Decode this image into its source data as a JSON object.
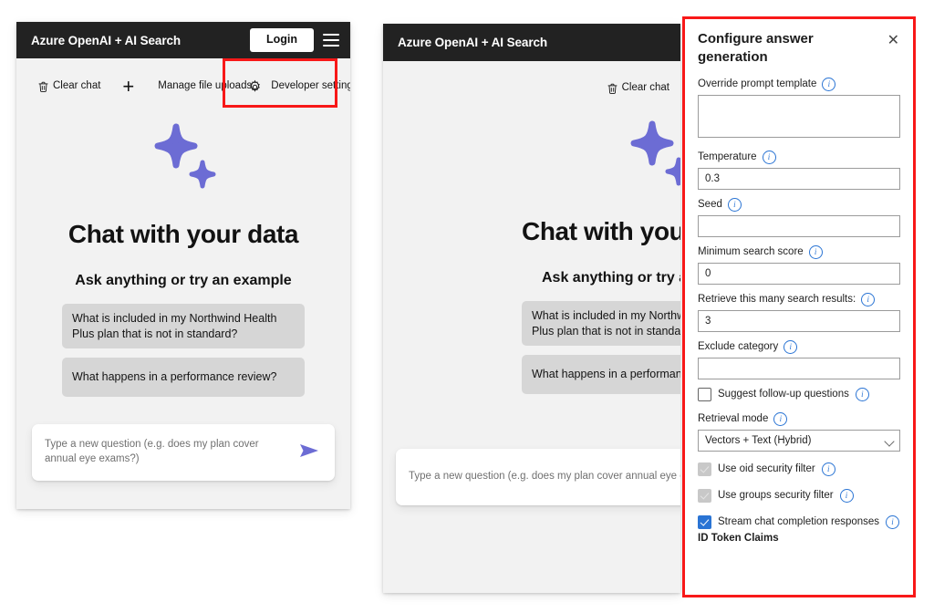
{
  "app": {
    "title": "Azure OpenAI + AI Search",
    "login_label": "Login",
    "menu_icon": "hamburger-menu-icon"
  },
  "command_bar": {
    "clear_chat_label": "Clear chat",
    "clear_chat_icon": "trash-icon",
    "add_icon": "plus-icon",
    "manage_uploads_label": "Manage file uploads",
    "developer_settings_label": "Developer settings",
    "developer_settings_icon": "gear-icon"
  },
  "chat": {
    "sparkle_icon": "sparkles-icon",
    "title": "Chat with your data",
    "subtitle": "Ask anything or try an example",
    "examples": [
      "What is included in my Northwind Health Plus plan that is not in standard?",
      "What happens in a performance review?"
    ],
    "input_placeholder": "Type a new question (e.g. does my plan cover annual eye exams?)",
    "send_icon": "send-arrow-icon"
  },
  "settings": {
    "title": "Configure answer generation",
    "close_icon": "close-icon",
    "info_icon": "info-icon",
    "fields": {
      "override_prompt": {
        "label": "Override prompt template",
        "value": ""
      },
      "temperature": {
        "label": "Temperature",
        "value": "0.3"
      },
      "seed": {
        "label": "Seed",
        "value": ""
      },
      "min_search_score": {
        "label": "Minimum search score",
        "value": "0"
      },
      "retrieve_count": {
        "label": "Retrieve this many search results:",
        "value": "3"
      },
      "exclude_category": {
        "label": "Exclude category",
        "value": ""
      },
      "retrieval_mode": {
        "label": "Retrieval mode",
        "value": "Vectors + Text (Hybrid)"
      }
    },
    "checkboxes": [
      {
        "label": "Suggest follow-up questions",
        "state": "unchecked"
      },
      {
        "label": "Use oid security filter",
        "state": "disabled-checked"
      },
      {
        "label": "Use groups security filter",
        "state": "disabled-checked"
      },
      {
        "label": "Stream chat completion responses",
        "state": "checked"
      }
    ],
    "id_token_claims_title": "ID Token Claims"
  },
  "colors": {
    "accent": "#6c6cd4",
    "annotation": "#f81818",
    "header_bg": "#222222",
    "panel_bg": "#f2f2f2",
    "checkbox_blue": "#2a74d4"
  }
}
